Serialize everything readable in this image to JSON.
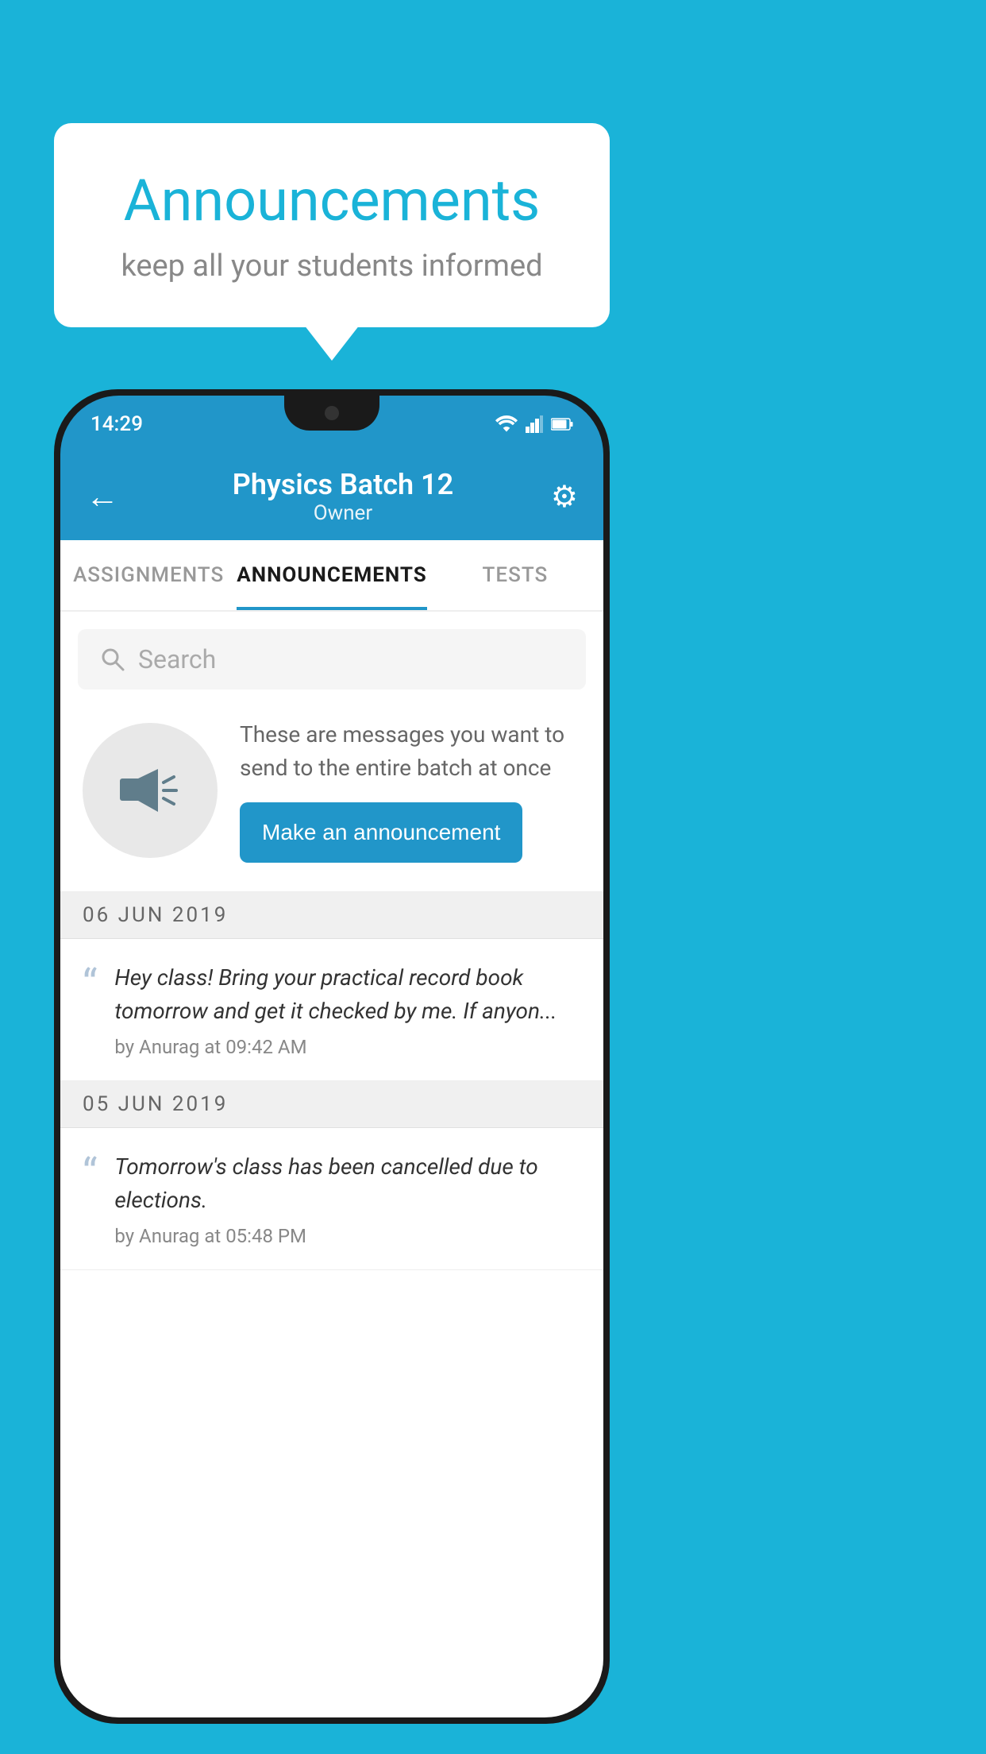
{
  "background_color": "#1ab3d8",
  "speech_bubble": {
    "title": "Announcements",
    "subtitle": "keep all your students informed"
  },
  "phone": {
    "status_bar": {
      "time": "14:29"
    },
    "app_bar": {
      "batch_name": "Physics Batch 12",
      "batch_role": "Owner",
      "back_icon": "←",
      "settings_icon": "⚙"
    },
    "tabs": [
      {
        "label": "ASSIGNMENTS",
        "active": false
      },
      {
        "label": "ANNOUNCEMENTS",
        "active": true
      },
      {
        "label": "TESTS",
        "active": false
      }
    ],
    "search": {
      "placeholder": "Search"
    },
    "promo": {
      "description": "These are messages you want to send to the entire batch at once",
      "button_label": "Make an announcement"
    },
    "announcements": [
      {
        "date": "06  JUN  2019",
        "message": "Hey class! Bring your practical record book tomorrow and get it checked by me. If anyon...",
        "author": "by Anurag at 09:42 AM"
      },
      {
        "date": "05  JUN  2019",
        "message": "Tomorrow's class has been cancelled due to elections.",
        "author": "by Anurag at 05:48 PM"
      }
    ]
  }
}
